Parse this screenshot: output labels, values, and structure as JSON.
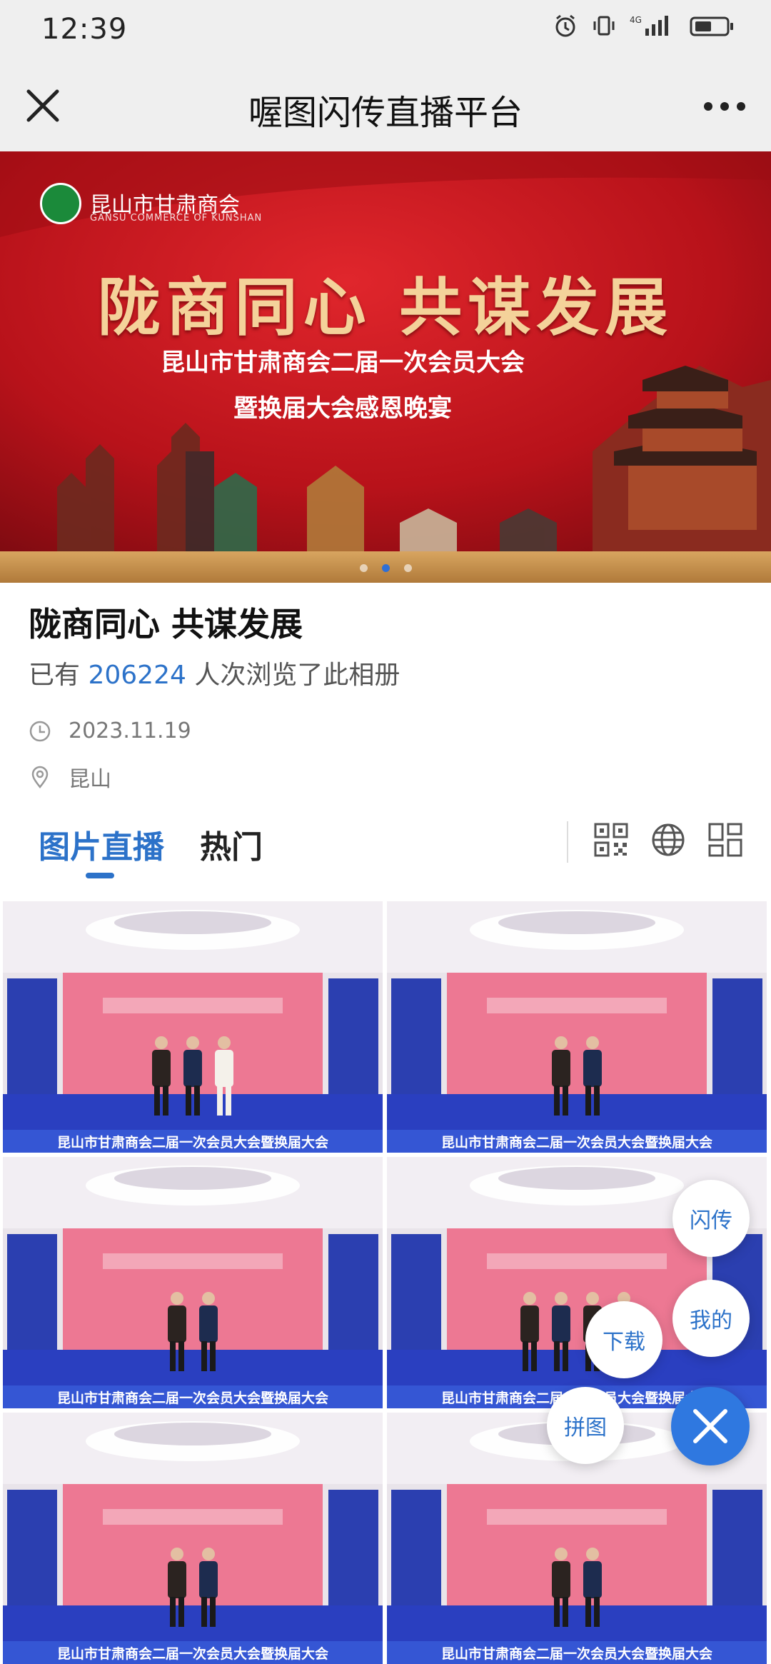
{
  "status_bar": {
    "time": "12:39",
    "network": "4G"
  },
  "nav": {
    "title": "喔图闪传直播平台"
  },
  "banner": {
    "org_name": "昆山市甘肃商会",
    "org_name_en": "GANSU COMMERCE OF KUNSHAN",
    "slogan": "陇商同心 共谋发展",
    "line1": "昆山市甘肃商会二届一次会员大会",
    "line2": "暨换届大会感恩晚宴",
    "slide_count": 3,
    "active_slide": 2
  },
  "album": {
    "title": "陇商同心 共谋发展",
    "views_prefix": "已有",
    "views_count": "206224",
    "views_suffix": "人次浏览了此相册",
    "date": "2023.11.19",
    "location": "昆山"
  },
  "tabs": [
    {
      "label": "图片直播",
      "active": true
    },
    {
      "label": "热门",
      "active": false
    }
  ],
  "tab_icons": [
    "qrcode-icon",
    "globe-icon",
    "grid-layout-icon"
  ],
  "photo_banner_text": "昆山市甘肃商会二届一次会员大会暨换届大会",
  "photos": [
    {
      "people": 3
    },
    {
      "people": 2
    },
    {
      "people": 2
    },
    {
      "people": 4
    },
    {
      "people": 2
    },
    {
      "people": 2
    }
  ],
  "fab": {
    "flash": "闪传",
    "mine": "我的",
    "download": "下载",
    "collage": "拼图"
  },
  "colors": {
    "accent": "#2c72c9",
    "banner_red": "#c4151c",
    "gold": "#f4d29a"
  }
}
